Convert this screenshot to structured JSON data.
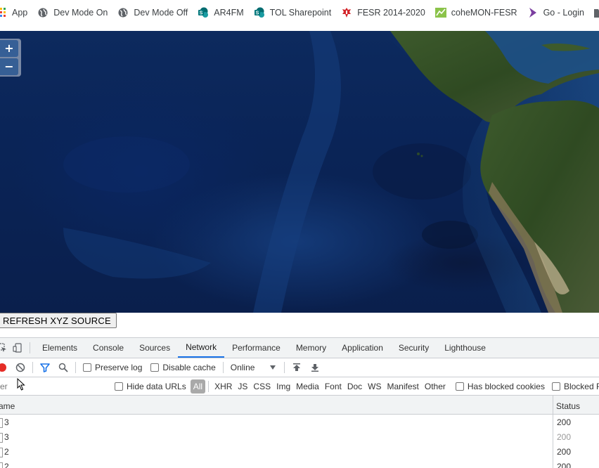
{
  "bookmarks": [
    {
      "label": "App",
      "icon": "apps-grid-icon"
    },
    {
      "label": "Dev Mode On",
      "icon": "globe-icon"
    },
    {
      "label": "Dev Mode Off",
      "icon": "globe-icon"
    },
    {
      "label": "AR4FM",
      "icon": "sharepoint-icon"
    },
    {
      "label": "TOL Sharepoint",
      "icon": "sharepoint-icon"
    },
    {
      "label": "FESR 2014-2020",
      "icon": "fesr-icon"
    },
    {
      "label": "coheMON-FESR",
      "icon": "cohemon-icon"
    },
    {
      "label": "Go - Login",
      "icon": "go-icon"
    },
    {
      "label": "",
      "icon": "folder-icon"
    }
  ],
  "map": {
    "zoom_in": "+",
    "zoom_out": "−"
  },
  "refresh_button": "REFRESH XYZ SOURCE",
  "devtools": {
    "tabs": [
      "Elements",
      "Console",
      "Sources",
      "Network",
      "Performance",
      "Memory",
      "Application",
      "Security",
      "Lighthouse"
    ],
    "active_tab": "Network",
    "toolbar": {
      "preserve_log": "Preserve log",
      "disable_cache": "Disable cache",
      "throttling": "Online"
    },
    "filter": {
      "placeholder": "lter",
      "hide_data_urls": "Hide data URLs",
      "types": [
        "All",
        "XHR",
        "JS",
        "CSS",
        "Img",
        "Media",
        "Font",
        "Doc",
        "WS",
        "Manifest",
        "Other"
      ],
      "active_type": "All",
      "has_blocked_cookies": "Has blocked cookies",
      "blocked_requests": "Blocked R"
    },
    "columns": {
      "name": "ame",
      "status": "Status"
    },
    "rows": [
      {
        "name": "3",
        "status": "200",
        "dim": false
      },
      {
        "name": "3",
        "status": "200",
        "dim": true
      },
      {
        "name": "2",
        "status": "200",
        "dim": false
      },
      {
        "name": "2",
        "status": "200",
        "dim": false
      }
    ]
  },
  "colors": {
    "accent": "#1a73e8",
    "record": "#e52d27",
    "filter_icon": "#1a73e8",
    "ocean": "#0a2457",
    "land": "#3b5a2a"
  }
}
